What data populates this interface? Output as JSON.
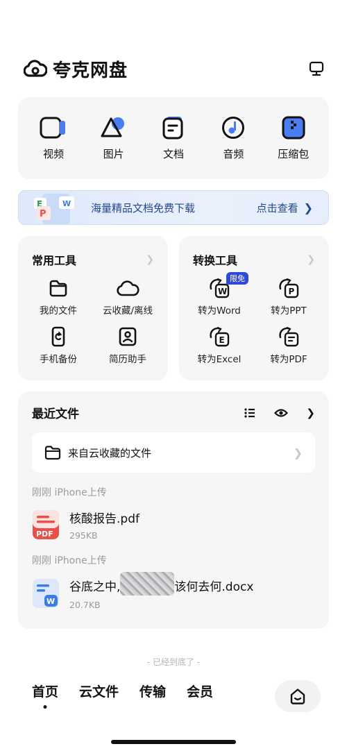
{
  "app": {
    "title": "夸克网盘"
  },
  "media": [
    {
      "label": "视频",
      "icon": "video-icon"
    },
    {
      "label": "图片",
      "icon": "image-icon"
    },
    {
      "label": "文档",
      "icon": "document-icon"
    },
    {
      "label": "音频",
      "icon": "audio-icon"
    },
    {
      "label": "压缩包",
      "icon": "archive-icon"
    }
  ],
  "banner": {
    "text": "海量精品文档免费下载",
    "link": "点击查看",
    "icon_letters": [
      "E",
      "W",
      "P"
    ]
  },
  "common_tools": {
    "title": "常用工具",
    "items": [
      {
        "label": "我的文件",
        "icon": "folder-icon"
      },
      {
        "label": "云收藏/离线",
        "icon": "cloud-icon"
      },
      {
        "label": "手机备份",
        "icon": "phone-backup-icon"
      },
      {
        "label": "简历助手",
        "icon": "resume-icon"
      }
    ]
  },
  "convert_tools": {
    "title": "转换工具",
    "badge": "限免",
    "items": [
      {
        "label": "转为Word",
        "icon": "word-icon",
        "letter": "W"
      },
      {
        "label": "转为PPT",
        "icon": "ppt-icon",
        "letter": "P"
      },
      {
        "label": "转为Excel",
        "icon": "excel-icon",
        "letter": "E"
      },
      {
        "label": "转为PDF",
        "icon": "pdf-convert-icon",
        "letter": ""
      }
    ]
  },
  "recent": {
    "title": "最近文件",
    "folder_text": "来自云收藏的文件",
    "groups": [
      {
        "label": "刚刚  iPhone上传",
        "file": {
          "name": "核酸报告.pdf",
          "size": "295KB",
          "type_label": "PDF"
        }
      },
      {
        "label": "刚刚  iPhone上传",
        "file": {
          "name_prefix": "谷底之中,",
          "name_suffix": "该何去何.docx",
          "size": "20.7KB",
          "type_label": "W"
        }
      }
    ]
  },
  "end_hint": "- 已经到底了 -",
  "nav": [
    {
      "label": "首页"
    },
    {
      "label": "云文件"
    },
    {
      "label": "传输"
    },
    {
      "label": "会员"
    }
  ],
  "colors": {
    "accent": "#2f49d6",
    "pdf_red": "#e8504a",
    "word_blue": "#3a7fe0"
  }
}
